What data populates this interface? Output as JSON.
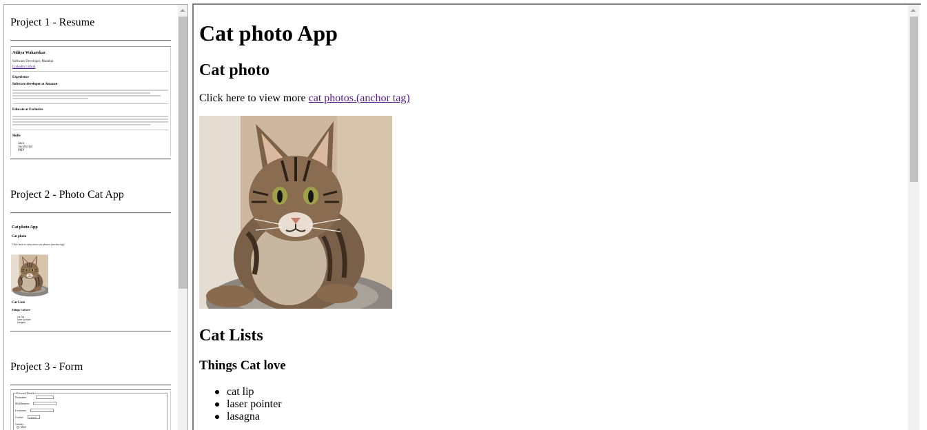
{
  "left_panel": {
    "projects": [
      {
        "title": "Project 1 - Resume"
      },
      {
        "title": "Project 2 - Photo Cat App"
      },
      {
        "title": "Project 3 - Form"
      }
    ],
    "resume_preview": {
      "name": "Aditya Wakarekar",
      "role": "Software Developer, Mumbai",
      "link": "Linkedin Github",
      "experience": "Experience",
      "job1": "Software developer at Amazon",
      "job2": "Educate at Exclusive",
      "skills": "Skills",
      "skill_items": [
        "Java",
        "JavaScript",
        "PHP"
      ]
    },
    "cat_preview": {
      "title": "Cat photo App",
      "subtitle": "Cat photo",
      "text": "Click here to view more cat photos.(anchor tag)",
      "lists": "Cat Lists",
      "love": "Things Cat love",
      "items": [
        "cat lip",
        "laser pointer",
        "lasagna"
      ]
    },
    "form_preview": {
      "legend": "Personal Details",
      "firstname": "Firstname:",
      "middlename": "Middlename:",
      "lastname": "Lastname:",
      "course": "Course:",
      "course_value": "Course ▾",
      "gender": "Gender:",
      "male": "Male"
    }
  },
  "main": {
    "heading": "Cat photo App",
    "subheading": "Cat photo",
    "view_text": "Click here to view more ",
    "view_link": "cat photos.(anchor tag)",
    "lists_heading": "Cat Lists",
    "love_heading": "Things Cat love",
    "love_items": [
      "cat lip",
      "laser pointer",
      "lasagna"
    ]
  },
  "colors": {
    "link": "#551a8b",
    "scrollbar_track": "#f1f1f1",
    "scrollbar_thumb": "#c1c1c1",
    "frame_border": "#808080"
  }
}
